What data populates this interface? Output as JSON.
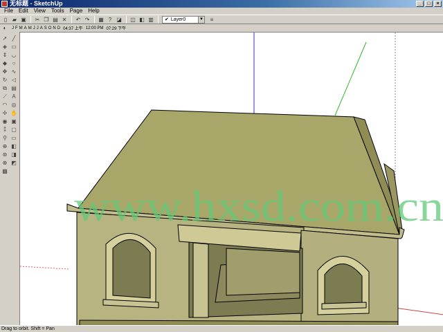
{
  "window": {
    "title": "无标题 - SketchUp",
    "minimize_label": "_",
    "maximize_label": "□",
    "close_label": "×"
  },
  "menu": [
    "File",
    "Edit",
    "View",
    "Tools",
    "Page",
    "Help"
  ],
  "toolbar": {
    "layer_label": "Layer0",
    "layer_check": "✔"
  },
  "shadow_bar": {
    "months": [
      "J",
      "F",
      "M",
      "A",
      "M",
      "J",
      "J",
      "A",
      "S",
      "O",
      "N",
      "D"
    ],
    "time_start": "04:37 上午",
    "time_mid": "12:00 PM",
    "time_end": "07:29 下午"
  },
  "watermark": "www.hxsd.com.cn",
  "status": "Drag to orbit.  Shift = Pan",
  "colors": {
    "wall": "#b8b482",
    "roof": "#a8a668",
    "axis_red": "#d24040",
    "axis_green": "#2eb82e",
    "axis_blue": "#2e2ec8"
  }
}
